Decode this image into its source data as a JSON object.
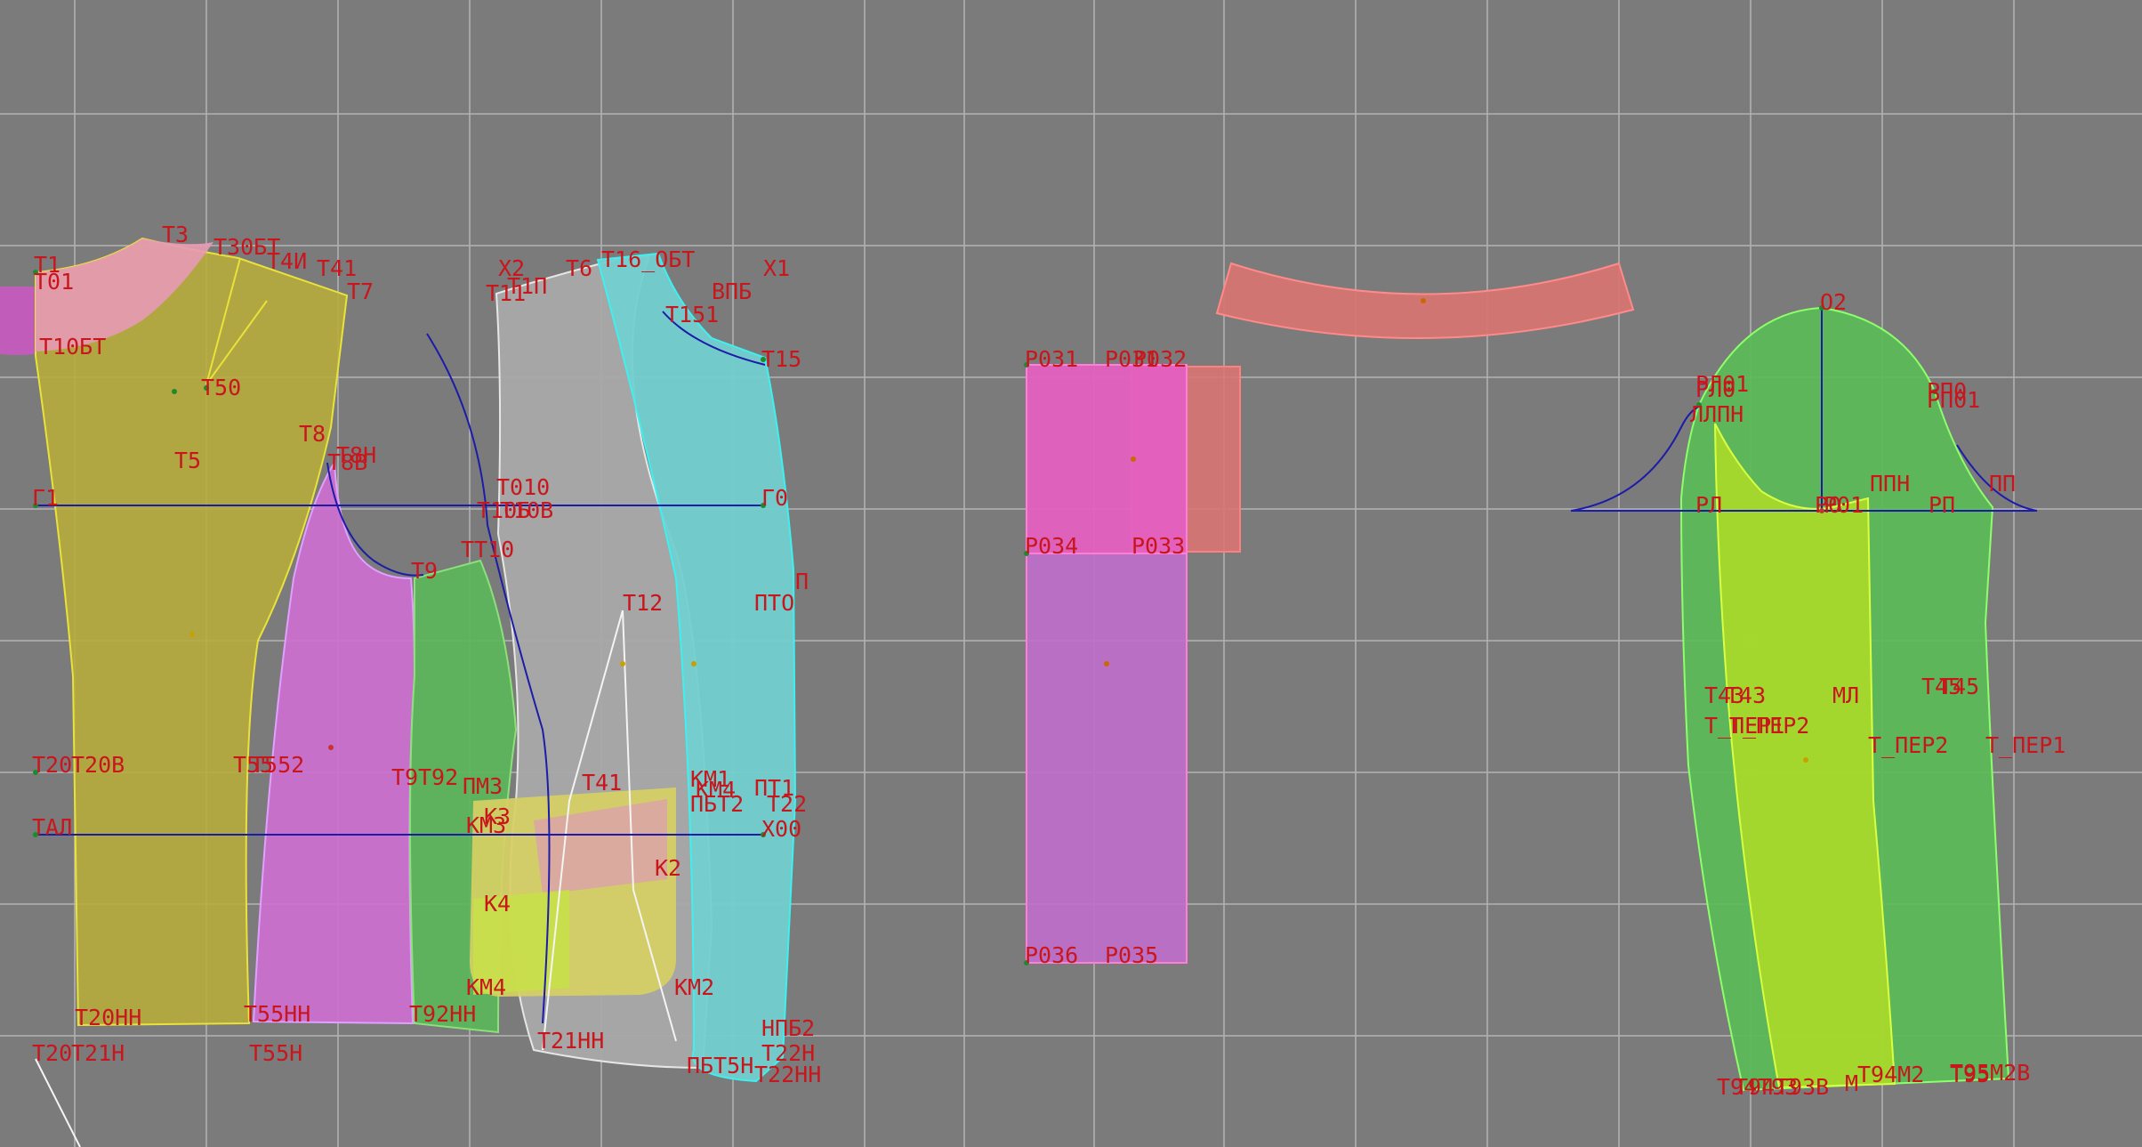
{
  "canvas": {
    "background": "#7b7b7b",
    "grid_color": "#b4b4b4",
    "label_color": "#c8161d",
    "guide_color": "#1c1ca8"
  },
  "pieces": {
    "back": {
      "fill": "#b7ac3c",
      "stroke": "#e8e23a"
    },
    "back_yoke": {
      "fill": "#e89ab4"
    },
    "side_back": {
      "fill": "#cc6fd0",
      "stroke": "#e0a0ff"
    },
    "side_front": {
      "fill": "#5bb55a"
    },
    "front": {
      "fill": "#a9a9a9",
      "stroke": "#e6e6e6"
    },
    "facing": {
      "fill": "#72cfcf",
      "stroke": "#3ef0f0"
    },
    "pocket": {
      "fill": "#d6d064"
    },
    "pocket_flap": {
      "fill": "#d9a8a0"
    },
    "pocket_strip": {
      "fill": "#c8e048"
    },
    "belt_pink": {
      "fill": "#e460c0",
      "stroke": "#ff7ed8"
    },
    "belt_purple": {
      "fill": "#bd70c8"
    },
    "belt_salmon": {
      "fill": "#d87472",
      "stroke": "#ff8080"
    },
    "collar": {
      "fill": "#d87472",
      "stroke": "#ff8a8a"
    },
    "sleeve_top": {
      "fill": "#5cba58",
      "stroke": "#8cff6a"
    },
    "sleeve_under": {
      "fill": "#a8d82c",
      "stroke": "#d8ff40"
    }
  },
  "labels": {
    "back": [
      "Т1",
      "Т01",
      "Т3",
      "Т30БТ",
      "Т4И",
      "Т41",
      "Т7",
      "Т10БТ",
      "Т50",
      "Т8",
      "Т5",
      "Т8Н",
      "Т8В",
      "Г1",
      "Т20",
      "Т20В",
      "Т55",
      "Т552",
      "ТАЛ",
      "Т20НН",
      "Т20",
      "Т21Н",
      "Т55Н",
      "Т55НН",
      "Т9"
    ],
    "front": [
      "Х2",
      "Т6",
      "Т16_ОБТ",
      "Х1",
      "Т11",
      "Т1П",
      "ВПБ",
      "Т151",
      "Т15",
      "Т010",
      "Т10Б",
      "Т10В",
      "Г0",
      "ТТ10",
      "П",
      "ПТО",
      "Т12",
      "Т9",
      "Т92",
      "ПМ3",
      "КМ1",
      "Т41",
      "ПТ1",
      "КМ4",
      "ПБТ2",
      "Т22",
      "Х00",
      "К3",
      "КМ3",
      "К2",
      "К4",
      "КМ4",
      "КМ2",
      "НПБ2",
      "Т22Н",
      "Т92НН",
      "Т21НН",
      "Т22НН",
      "ПБТ5Н"
    ],
    "belt": [
      "Р031",
      "Р031",
      "Р032",
      "Р034",
      "Р033",
      "Р036",
      "Р035"
    ],
    "sleeve": [
      "О2",
      "РЛ01",
      "РЛ0",
      "ЛЛПН",
      "РП0",
      "РП01",
      "ППН",
      "ПП",
      "РЛ",
      "РП",
      "Т43",
      "Т43",
      "МЛ",
      "Т45",
      "Т45",
      "Т_ПЕР1",
      "Т_ПЕР2",
      "Т_ПЕР2",
      "Т_ПЕР1",
      "Т94",
      "Т94",
      "Т93",
      "Т93В",
      "М",
      "Т94М2",
      "Т95",
      "Т95М2В",
      "Р0",
      "Р01"
    ]
  },
  "icons": {
    "pattern_point": "dot",
    "guide_line": "straight-line",
    "armhole_curve": "bezier-curve"
  }
}
